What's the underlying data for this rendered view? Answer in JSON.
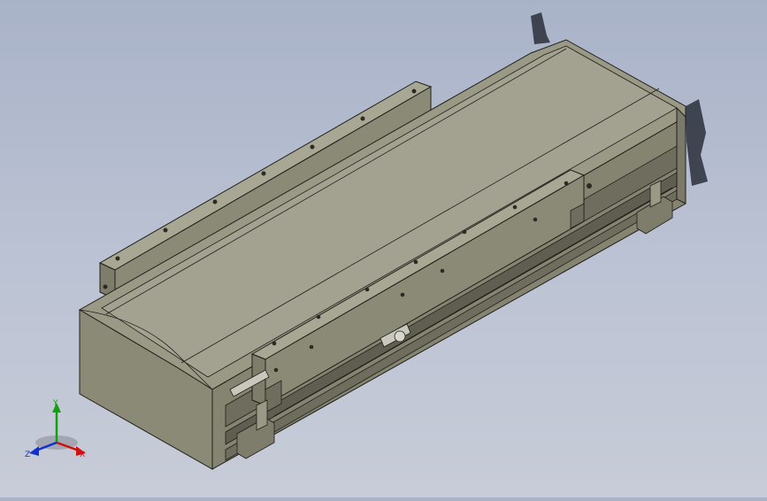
{
  "viewport": {
    "background_top": "#a9b3c8",
    "background_bottom": "#c8ccd8"
  },
  "model": {
    "body_color": "#8b8a77",
    "top_color": "#9a9986",
    "edge_color": "#1f1f1a",
    "shadow_color": "#2a2f3a"
  },
  "triad": {
    "x_label": "X",
    "y_label": "Y",
    "z_label": "Z",
    "x_color": "#d01010",
    "y_color": "#10a010",
    "z_color": "#1030d0"
  }
}
